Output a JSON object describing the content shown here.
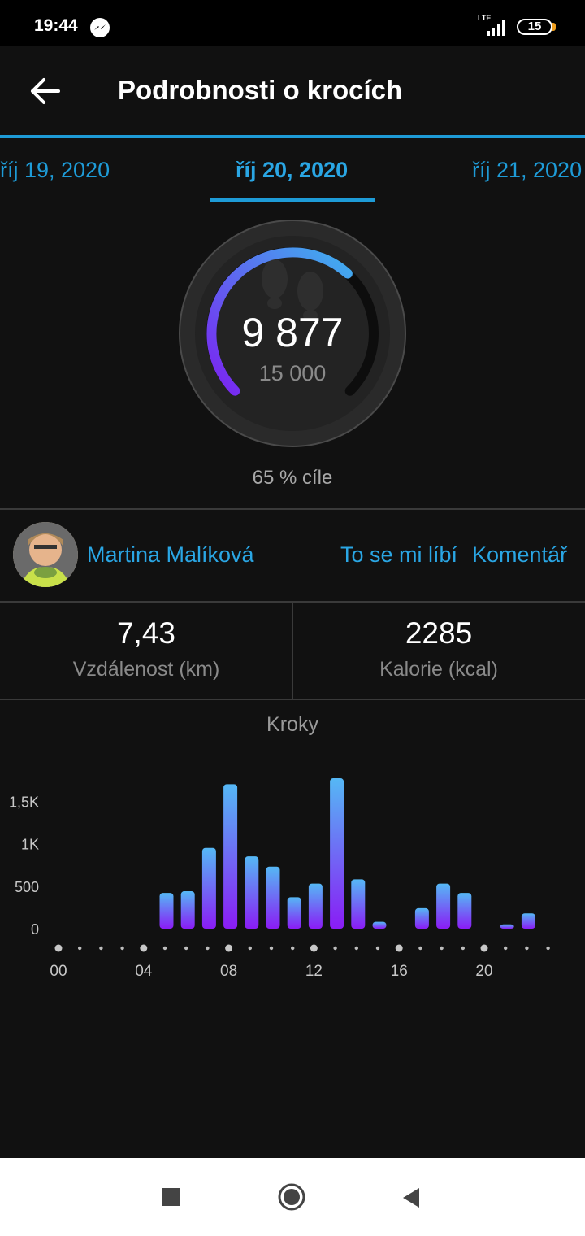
{
  "status": {
    "time": "19:44",
    "network": "LTE",
    "battery": "15"
  },
  "header": {
    "title": "Podrobnosti o krocích"
  },
  "dates": {
    "prev": "říj 19, 2020",
    "current": "říj 20, 2020",
    "next": "říj 21, 2020"
  },
  "summary": {
    "steps": "9 877",
    "goal": "15 000",
    "goal_percent_text": "65 % cíle",
    "progress_fraction": 0.6585
  },
  "social": {
    "user_name": "Martina Malíková",
    "like_label": "To se mi líbí",
    "comment_label": "Komentář"
  },
  "stats": {
    "distance_value": "7,43",
    "distance_label": "Vzdálenost (km)",
    "calories_value": "2285",
    "calories_label": "Kalorie (kcal)"
  },
  "colors": {
    "accent": "#1e9bd7",
    "bar_top": "#55b8f5",
    "bar_bottom": "#8a1cf5",
    "ring_start": "#7b22f0",
    "ring_end": "#3fb0ef"
  },
  "chart_data": {
    "type": "bar",
    "title": "Kroky",
    "x": [
      0,
      1,
      2,
      3,
      4,
      5,
      6,
      7,
      8,
      9,
      10,
      11,
      12,
      13,
      14,
      15,
      16,
      17,
      18,
      19,
      20,
      21,
      22,
      23
    ],
    "values": [
      0,
      0,
      0,
      0,
      0,
      420,
      440,
      950,
      1700,
      850,
      730,
      370,
      530,
      1770,
      580,
      80,
      0,
      240,
      530,
      420,
      0,
      50,
      180,
      0
    ],
    "xticks": [
      "00",
      "04",
      "08",
      "12",
      "16",
      "20"
    ],
    "yticks": [
      "0",
      "500",
      "1K",
      "1,5K"
    ],
    "ylim": [
      0,
      1800
    ],
    "grid": false
  }
}
